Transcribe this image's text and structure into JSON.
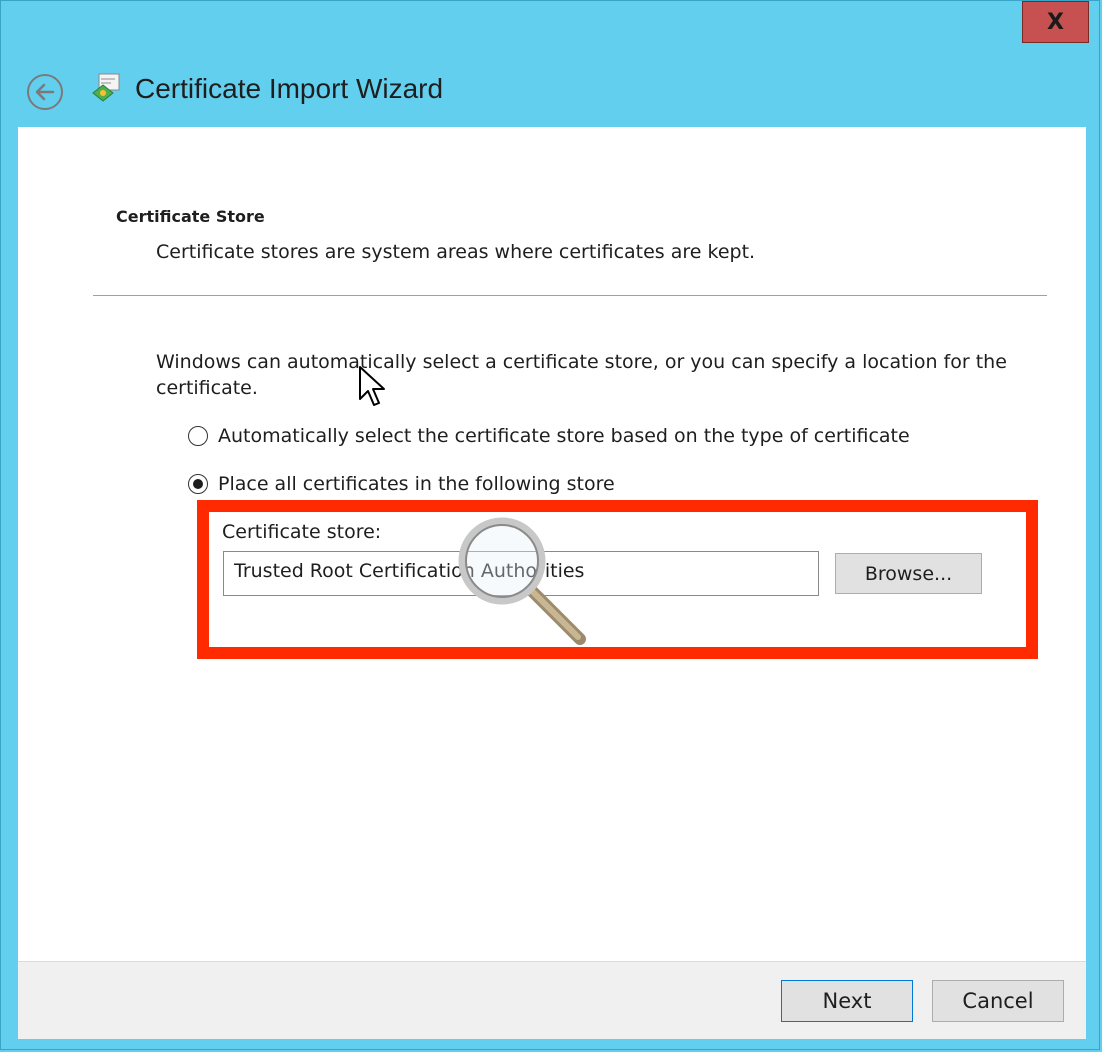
{
  "window": {
    "close_label": "X",
    "title": "Certificate Import Wizard"
  },
  "page": {
    "section_title": "Certificate Store",
    "section_desc": "Certificate stores are system areas where certificates are kept.",
    "intro": "Windows can automatically select a certificate store, or you can specify a location for the certificate."
  },
  "options": {
    "auto_label": "Automatically select the certificate store based on the type of certificate",
    "auto_selected": false,
    "place_label": "Place all certificates in the following store",
    "place_selected": true
  },
  "store": {
    "label": "Certificate store:",
    "value": "Trusted Root Certification Authorities",
    "browse_label": "Browse..."
  },
  "footer": {
    "next_label": "Next",
    "cancel_label": "Cancel"
  },
  "colors": {
    "frame": "#63cfee",
    "close": "#c75050",
    "highlight": "#ff2a00"
  }
}
